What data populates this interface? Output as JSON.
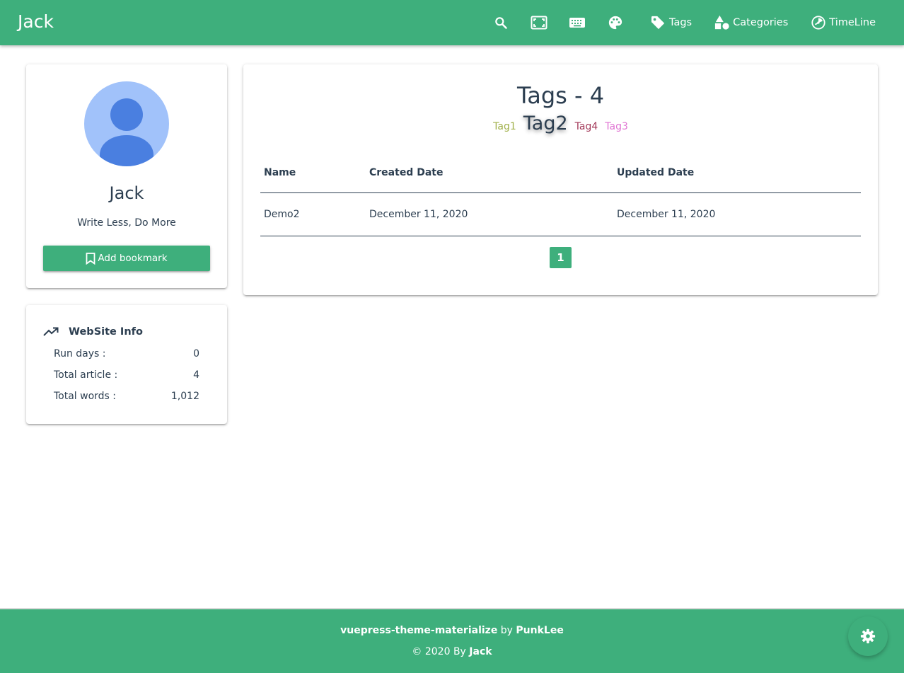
{
  "navbar": {
    "brand": "Jack",
    "icons": [
      "search-icon",
      "fullscreen-icon",
      "keyboard-icon",
      "palette-icon"
    ],
    "links": [
      {
        "label": "Tags",
        "icon": "tag-icon"
      },
      {
        "label": "Categories",
        "icon": "shapes-icon"
      },
      {
        "label": "TimeLine",
        "icon": "timeline-icon"
      }
    ]
  },
  "profile": {
    "name": "Jack",
    "description": "Write Less, Do More",
    "bookmark_label": "Add bookmark"
  },
  "website_info": {
    "title": "WebSite Info",
    "rows": [
      {
        "label": "Run days :",
        "value": "0"
      },
      {
        "label": "Total article :",
        "value": "4"
      },
      {
        "label": "Total words :",
        "value": "1,012"
      }
    ]
  },
  "tags_page": {
    "title": "Tags - 4",
    "tags": [
      {
        "label": "Tag1",
        "color": "#a0b04a",
        "active": false
      },
      {
        "label": "Tag2",
        "color": "#2c3e50",
        "active": true
      },
      {
        "label": "Tag4",
        "color": "#a33a5a",
        "active": false
      },
      {
        "label": "Tag3",
        "color": "#e075d3",
        "active": false
      }
    ],
    "table": {
      "headers": [
        "Name",
        "Created Date",
        "Updated Date"
      ],
      "rows": [
        [
          "Demo2",
          "December 11, 2020",
          "December 11, 2020"
        ]
      ]
    },
    "pagination": {
      "current": "1"
    }
  },
  "footer": {
    "theme_name": "vuepress-theme-materialize",
    "by_text": " by ",
    "theme_author": "PunkLee",
    "copyright_prefix": "© 2020 By ",
    "copyright_author": "Jack"
  },
  "colors": {
    "primary": "#3eaf7c",
    "text": "#2c3e50",
    "avatar_bg": "#a1c2fa",
    "avatar_fg": "#4a7fe0"
  }
}
